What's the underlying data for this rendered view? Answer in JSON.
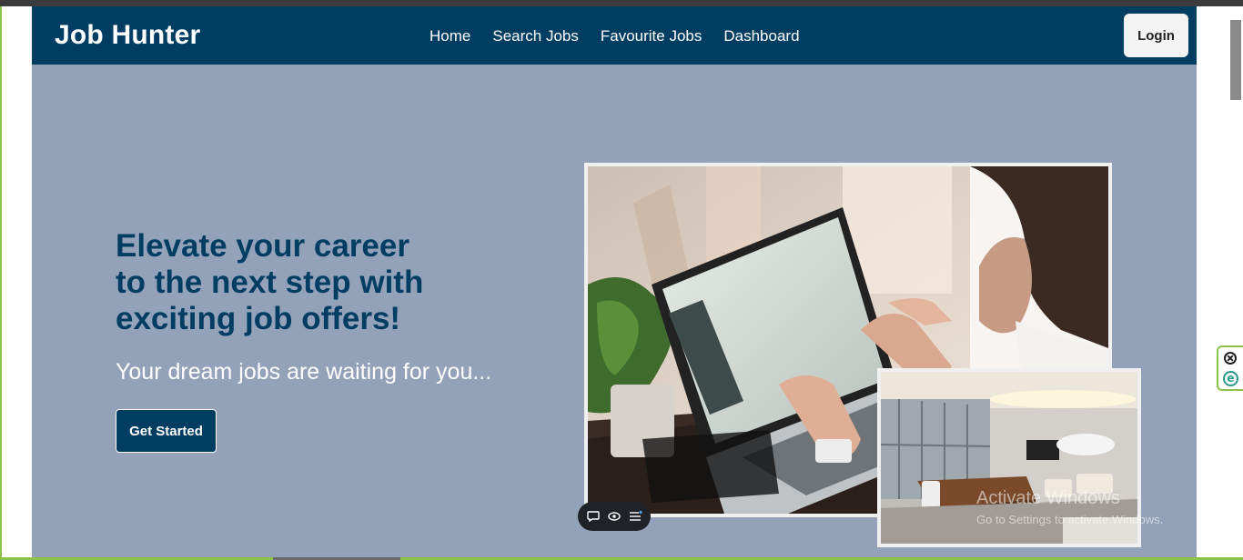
{
  "app": {
    "brand": "Job Hunter"
  },
  "nav": {
    "links": [
      "Home",
      "Search Jobs",
      "Favourite Jobs",
      "Dashboard"
    ],
    "login_label": "Login"
  },
  "hero": {
    "heading_lines": [
      "Elevate your career",
      "to the next step with",
      "exciting job offers!"
    ],
    "subheading": "Your dream jobs are waiting for you...",
    "cta_label": "Get Started"
  },
  "images": {
    "main_alt": "woman typing on laptop",
    "office_alt": "modern office meeting room"
  },
  "overlay": {
    "watermark_title": "Activate Windows",
    "watermark_sub": "Go to Settings to activate Windows."
  },
  "floating_toolbar": {
    "icons": [
      "chat-icon",
      "eye-icon",
      "menu-icon"
    ]
  },
  "side_widget": {
    "icons": [
      "close-icon",
      "edge-icon"
    ]
  },
  "colors": {
    "navbar": "#003d63",
    "hero_bg": "#93a2b9",
    "accent": "#003d63"
  }
}
